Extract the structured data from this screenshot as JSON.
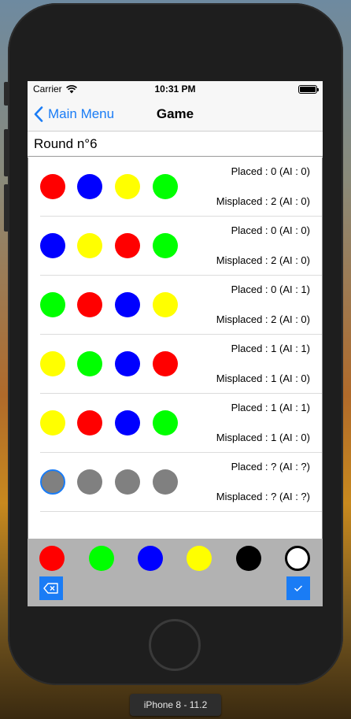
{
  "status_bar": {
    "carrier": "Carrier",
    "time": "10:31 PM"
  },
  "nav": {
    "back_label": "Main Menu",
    "title": "Game"
  },
  "round_label": "Round n°6",
  "colors": {
    "red": "#ff0000",
    "green": "#00ff00",
    "blue": "#0000ff",
    "yellow": "#ffff00",
    "black": "#000000",
    "white": "#ffffff",
    "gray": "#808080",
    "accent": "#1a7cf5"
  },
  "rows": [
    {
      "pegs": [
        "red",
        "blue",
        "yellow",
        "green"
      ],
      "placed": "Placed : 0 (AI : 0)",
      "misplaced": "Misplaced : 2 (AI : 0)"
    },
    {
      "pegs": [
        "blue",
        "yellow",
        "red",
        "green"
      ],
      "placed": "Placed : 0 (AI : 0)",
      "misplaced": "Misplaced : 2 (AI : 0)"
    },
    {
      "pegs": [
        "green",
        "red",
        "blue",
        "yellow"
      ],
      "placed": "Placed : 0 (AI : 1)",
      "misplaced": "Misplaced : 2 (AI : 0)"
    },
    {
      "pegs": [
        "yellow",
        "green",
        "blue",
        "red"
      ],
      "placed": "Placed : 1 (AI : 1)",
      "misplaced": "Misplaced : 1 (AI : 0)"
    },
    {
      "pegs": [
        "yellow",
        "red",
        "blue",
        "green"
      ],
      "placed": "Placed : 1 (AI : 1)",
      "misplaced": "Misplaced : 1 (AI : 0)"
    },
    {
      "pegs": [
        "gray",
        "gray",
        "gray",
        "gray"
      ],
      "placed": "Placed : ? (AI : ?)",
      "misplaced": "Misplaced : ? (AI : ?)"
    }
  ],
  "picker": {
    "colors": [
      "red",
      "green",
      "blue",
      "yellow",
      "black",
      "white"
    ],
    "delete_icon": "backspace-icon",
    "confirm_icon": "checkmark-icon"
  },
  "device_label": "iPhone 8 - 11.2"
}
